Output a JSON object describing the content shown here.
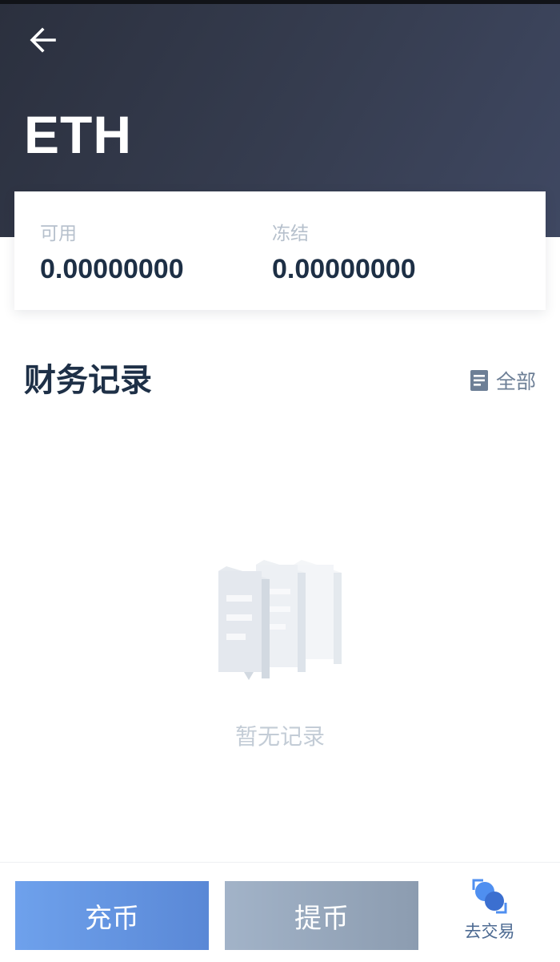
{
  "header": {
    "coin": "ETH"
  },
  "balance": {
    "available_label": "可用",
    "available_value": "0.00000000",
    "frozen_label": "冻结",
    "frozen_value": "0.00000000"
  },
  "records": {
    "title": "财务记录",
    "view_all_label": "全部",
    "empty_text": "暂无记录"
  },
  "actions": {
    "deposit_label": "充币",
    "withdraw_label": "提币",
    "trade_label": "去交易"
  },
  "icons": {
    "back": "arrow-left-icon",
    "view_all": "document-list-icon",
    "trade": "exchange-circles-icon",
    "empty": "empty-documents-illustration"
  },
  "colors": {
    "header_dark": "#2b303e",
    "deposit_button": "#5a88d6",
    "withdraw_button": "#8c9cb0",
    "title_text": "#1e3047",
    "trade_accent": "#4f8ff0"
  }
}
